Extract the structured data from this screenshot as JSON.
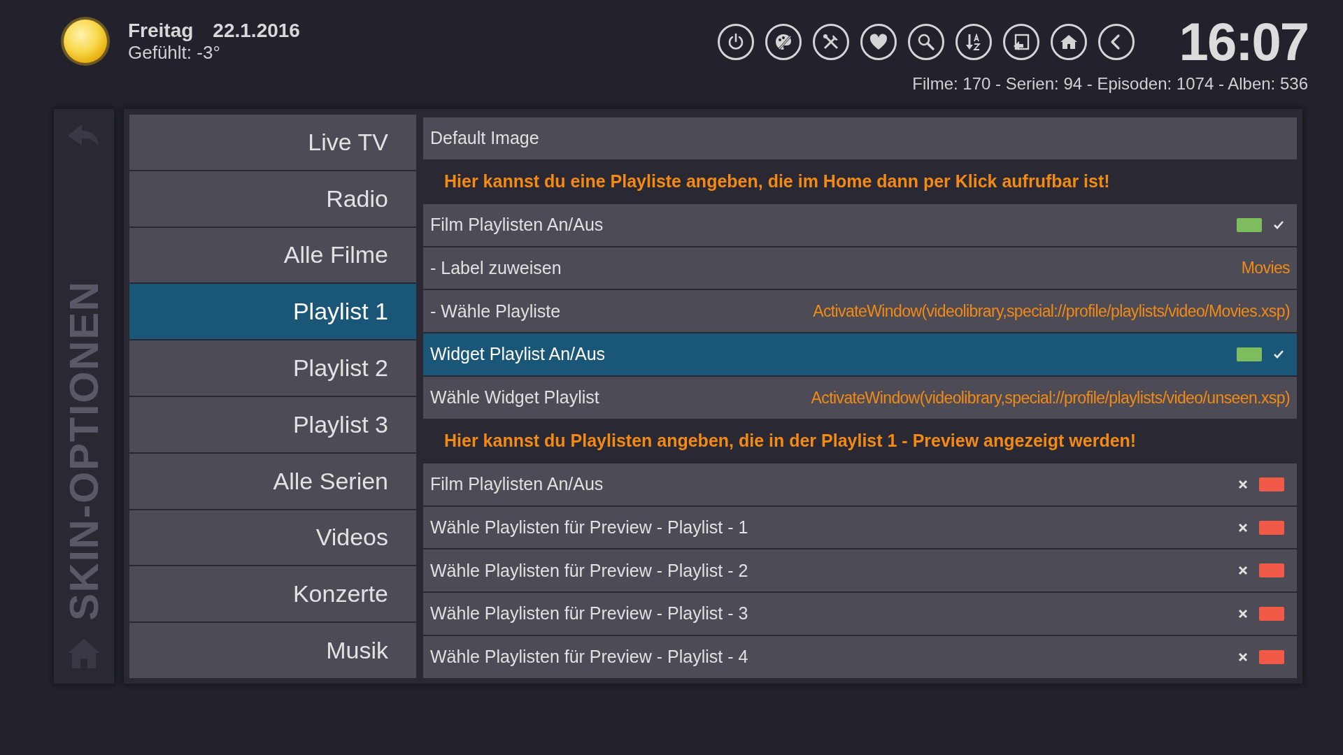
{
  "weather": {
    "day": "Freitag",
    "date": "22.1.2016",
    "feels": "Gefühlt: -3°"
  },
  "clock": "16:07",
  "stats": "Filme: 170 - Serien: 94 - Episoden: 1074 - Alben: 536",
  "side_title": "SKIN-OPTIONEN",
  "menu": [
    {
      "label": "Live TV",
      "selected": false
    },
    {
      "label": "Radio",
      "selected": false
    },
    {
      "label": "Alle Filme",
      "selected": false
    },
    {
      "label": "Playlist 1",
      "selected": true
    },
    {
      "label": "Playlist 2",
      "selected": false
    },
    {
      "label": "Playlist 3",
      "selected": false
    },
    {
      "label": "Alle Serien",
      "selected": false
    },
    {
      "label": "Videos",
      "selected": false
    },
    {
      "label": "Konzerte",
      "selected": false
    },
    {
      "label": "Musik",
      "selected": false
    }
  ],
  "settings": [
    {
      "kind": "text",
      "label": "Default Image",
      "selected": false
    },
    {
      "kind": "header",
      "label": "Hier kannst du eine Playliste angeben, die im Home dann per Klick aufrufbar ist!"
    },
    {
      "kind": "toggle",
      "label": "Film Playlisten An/Aus",
      "on": true,
      "selected": false
    },
    {
      "kind": "value",
      "label": " - Label zuweisen",
      "value": "Movies",
      "selected": false
    },
    {
      "kind": "value",
      "label": "- Wähle Playliste",
      "value": "ActivateWindow(videolibrary,special://profile/playlists/video/Movies.xsp)",
      "selected": false
    },
    {
      "kind": "toggle",
      "label": "Widget Playlist An/Aus",
      "on": true,
      "selected": true
    },
    {
      "kind": "value",
      "label": "Wähle Widget Playlist",
      "value": "ActivateWindow(videolibrary,special://profile/playlists/video/unseen.xsp)",
      "selected": false
    },
    {
      "kind": "header",
      "label": "Hier kannst du Playlisten angeben, die in der Playlist 1 - Preview angezeigt werden!"
    },
    {
      "kind": "toggle",
      "label": "Film Playlisten An/Aus",
      "on": false,
      "selected": false
    },
    {
      "kind": "toggle",
      "label": "Wähle Playlisten für Preview - Playlist - 1",
      "on": false,
      "selected": false
    },
    {
      "kind": "toggle",
      "label": "Wähle Playlisten für Preview - Playlist - 2",
      "on": false,
      "selected": false
    },
    {
      "kind": "toggle",
      "label": "Wähle Playlisten für Preview - Playlist - 3",
      "on": false,
      "selected": false
    },
    {
      "kind": "toggle",
      "label": "Wähle Playlisten für Preview - Playlist - 4",
      "on": false,
      "selected": false
    }
  ]
}
